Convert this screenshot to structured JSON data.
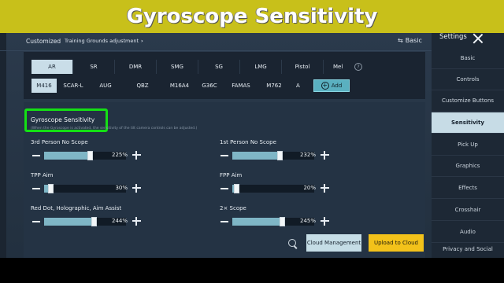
{
  "banner": {
    "title": "Gyroscope Sensitivity"
  },
  "header": {
    "customized_label": "Customized",
    "scheme_label": "Training Grounds adjustment",
    "scheme_chevron": "›",
    "basic_label": "Basic"
  },
  "weapon_tabs": [
    "AR",
    "SR",
    "DMR",
    "SMG",
    "SG",
    "LMG",
    "Pistol",
    "Mel"
  ],
  "selected_tab": "AR",
  "help_symbol": "?",
  "guns": [
    "M416",
    "SCAR-L",
    "AUG",
    "QBZ",
    "M16A4",
    "G36C",
    "FAMAS",
    "M762",
    "A"
  ],
  "selected_gun": "M416",
  "add_button": {
    "icon": "+",
    "label": "Add"
  },
  "section": {
    "title": "Gyroscope Sensitivity",
    "description": "(When the Gyroscope is activated, the sensitivity of the tilt camera controls can be adjusted.)"
  },
  "sliders": [
    {
      "label": "3rd Person No Scope",
      "value": 225,
      "display": "225%",
      "fill": 0.56
    },
    {
      "label": "1st Person No Scope",
      "value": 232,
      "display": "232%",
      "fill": 0.58
    },
    {
      "label": "TPP Aim",
      "value": 30,
      "display": "30%",
      "fill": 0.08
    },
    {
      "label": "FPP Aim",
      "value": 20,
      "display": "20%",
      "fill": 0.05
    },
    {
      "label": "Red Dot, Holographic, Aim Assist",
      "value": 244,
      "display": "244%",
      "fill": 0.61
    },
    {
      "label": "2× Scope",
      "value": 245,
      "display": "245%",
      "fill": 0.61
    }
  ],
  "buttons": {
    "cloud": "Cloud Management",
    "upload": "Upload to Cloud"
  },
  "sidebar": {
    "title": "Settings",
    "items": [
      "Basic",
      "Controls",
      "Customize Buttons",
      "Sensitivity",
      "Pick Up",
      "Graphics",
      "Effects",
      "Crosshair",
      "Audio",
      "Privacy and Social"
    ],
    "selected": "Sensitivity"
  },
  "colors": {
    "accent": "#c9dde8",
    "highlight": "#14e014",
    "upload": "#f3c21a",
    "banner": "#c8c01a"
  }
}
